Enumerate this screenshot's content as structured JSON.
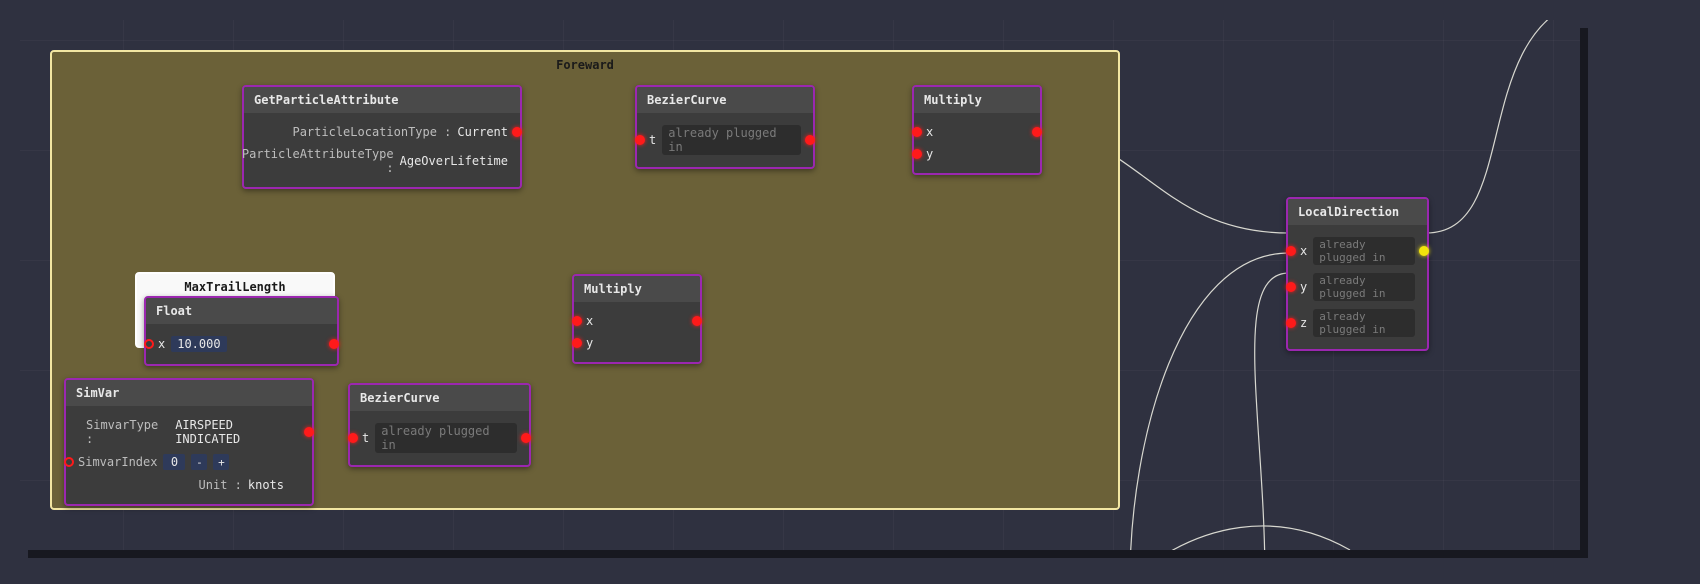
{
  "group": {
    "title": "Foreward"
  },
  "white_group": {
    "title": "MaxTrailLength"
  },
  "nodes": {
    "getParticleAttribute": {
      "title": "GetParticleAttribute",
      "rows": [
        {
          "label": "ParticleLocationType :",
          "value": "Current"
        },
        {
          "label": "ParticleAttributeType :",
          "value": "AgeOverLifetime"
        }
      ]
    },
    "bezier1": {
      "title": "BezierCurve",
      "t_label": "t",
      "plugged": "already plugged in"
    },
    "multiply1": {
      "title": "Multiply",
      "x_label": "x",
      "y_label": "y"
    },
    "float": {
      "title": "Float",
      "x_label": "x",
      "value": "10.000"
    },
    "multiply2": {
      "title": "Multiply",
      "x_label": "x",
      "y_label": "y"
    },
    "simvar": {
      "title": "SimVar",
      "type_label": "SimvarType :",
      "type_value": "AIRSPEED INDICATED",
      "index_label": "SimvarIndex",
      "index_value": "0",
      "unit_label": "Unit :",
      "unit_value": "knots"
    },
    "bezier2": {
      "title": "BezierCurve",
      "t_label": "t",
      "plugged": "already plugged in"
    },
    "localDirection": {
      "title": "LocalDirection",
      "x_label": "x",
      "x_plugged": "already plugged in",
      "y_label": "y",
      "y_plugged": "already plugged in",
      "z_label": "z",
      "z_plugged": "already plugged in"
    }
  },
  "stepper": {
    "minus": "-",
    "plus": "+"
  }
}
